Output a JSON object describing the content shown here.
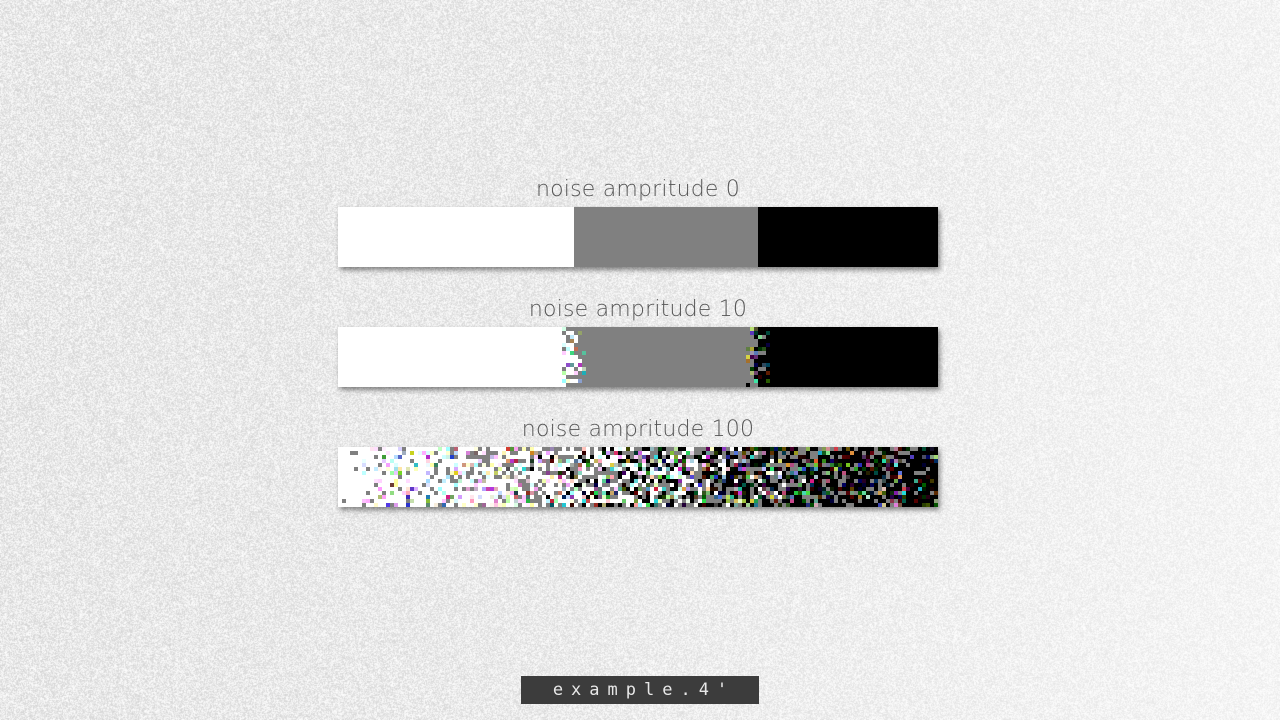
{
  "background": {
    "texture": "grain",
    "base_color": "#e9e9e9"
  },
  "demos": [
    {
      "label": "noise ampritude 0",
      "noise_amplitude": 0,
      "stops": [
        {
          "color": "#ffffff",
          "fraction": 0.39
        },
        {
          "color": "#808080",
          "fraction": 0.31
        },
        {
          "color": "#000000",
          "fraction": 0.3
        }
      ]
    },
    {
      "label": "noise ampritude 10",
      "noise_amplitude": 10,
      "stops": [
        {
          "color": "#ffffff",
          "fraction": 0.39
        },
        {
          "color": "#808080",
          "fraction": 0.31
        },
        {
          "color": "#000000",
          "fraction": 0.3
        }
      ]
    },
    {
      "label": "noise ampritude 100",
      "noise_amplitude": 100,
      "stops": [
        {
          "color": "#ffffff",
          "fraction": 0.39
        },
        {
          "color": "#808080",
          "fraction": 0.31
        },
        {
          "color": "#000000",
          "fraction": 0.3
        }
      ]
    }
  ],
  "footer": {
    "label": "example.4'"
  }
}
